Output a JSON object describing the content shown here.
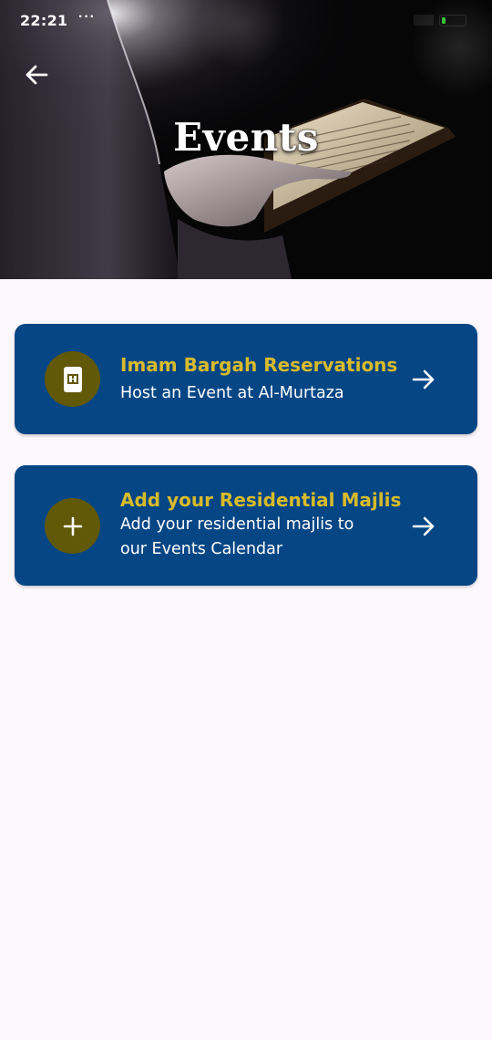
{
  "status_bar": {
    "time": "22:21",
    "overflow_dots": "···",
    "battery_color": "#39c233"
  },
  "header": {
    "title": "Events",
    "back_icon": "arrow-left-icon"
  },
  "cards": [
    {
      "icon": "reservation-document-icon",
      "title": "Imam Bargah Reservations",
      "subtitle": "Host an Event at Al-Murtaza",
      "arrow_icon": "arrow-right-icon"
    },
    {
      "icon": "plus-icon",
      "title": "Add your Residential Majlis",
      "subtitle": "Add your residential majlis to our Events Calendar",
      "arrow_icon": "arrow-right-icon"
    }
  ],
  "colors": {
    "card_background": "#064685",
    "card_title": "#d8bb2a",
    "icon_circle": "#615808",
    "page_background": "#fdf8fd"
  }
}
